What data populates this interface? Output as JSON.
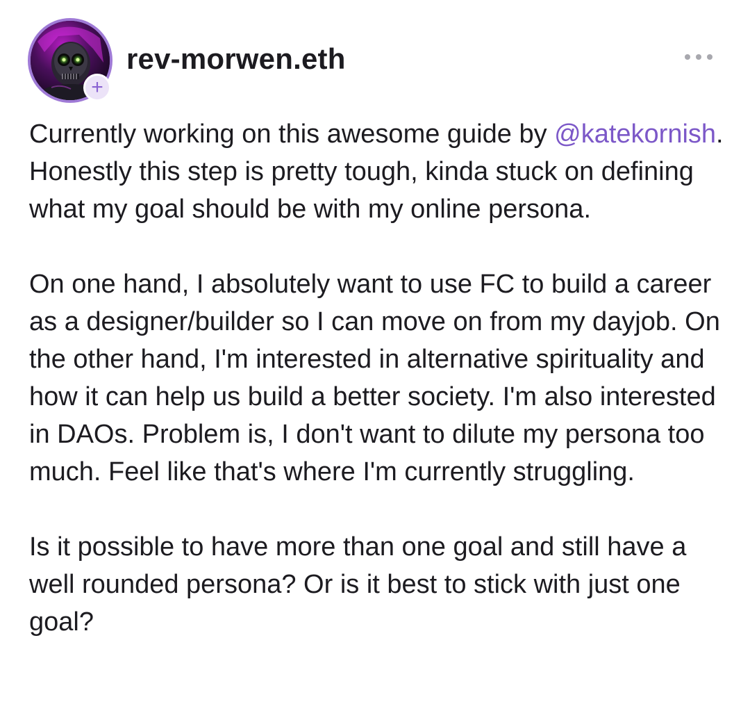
{
  "author": {
    "username": "rev-morwen.eth",
    "avatar_icon": "skull-avatar",
    "follow_icon": "plus-icon",
    "follow_symbol": "+"
  },
  "menu": {
    "icon": "ellipsis-icon"
  },
  "post": {
    "paragraph1_pre": "Currently working on this awesome guide by ",
    "mention": "@katekornish",
    "paragraph1_post": ". Honestly this step is pretty tough, kinda stuck on defining what my goal should be with my online persona.",
    "paragraph2": "On one hand, I absolutely want to use FC to build a career as a designer/builder so I can move on from my dayjob. On the other hand, I'm interested in alternative spirituality and how it can help us build a better society. I'm also interested in DAOs. Problem is, I don't want to dilute my persona too much. Feel like that's where I'm currently struggling.",
    "paragraph3": "Is it possible to have more than one goal and still have a well rounded persona? Or is it best to stick with just one goal?"
  },
  "colors": {
    "accent": "#8a63d2",
    "mention": "#7c58c8",
    "text": "#1c1b20",
    "muted": "#a8a8ae"
  }
}
